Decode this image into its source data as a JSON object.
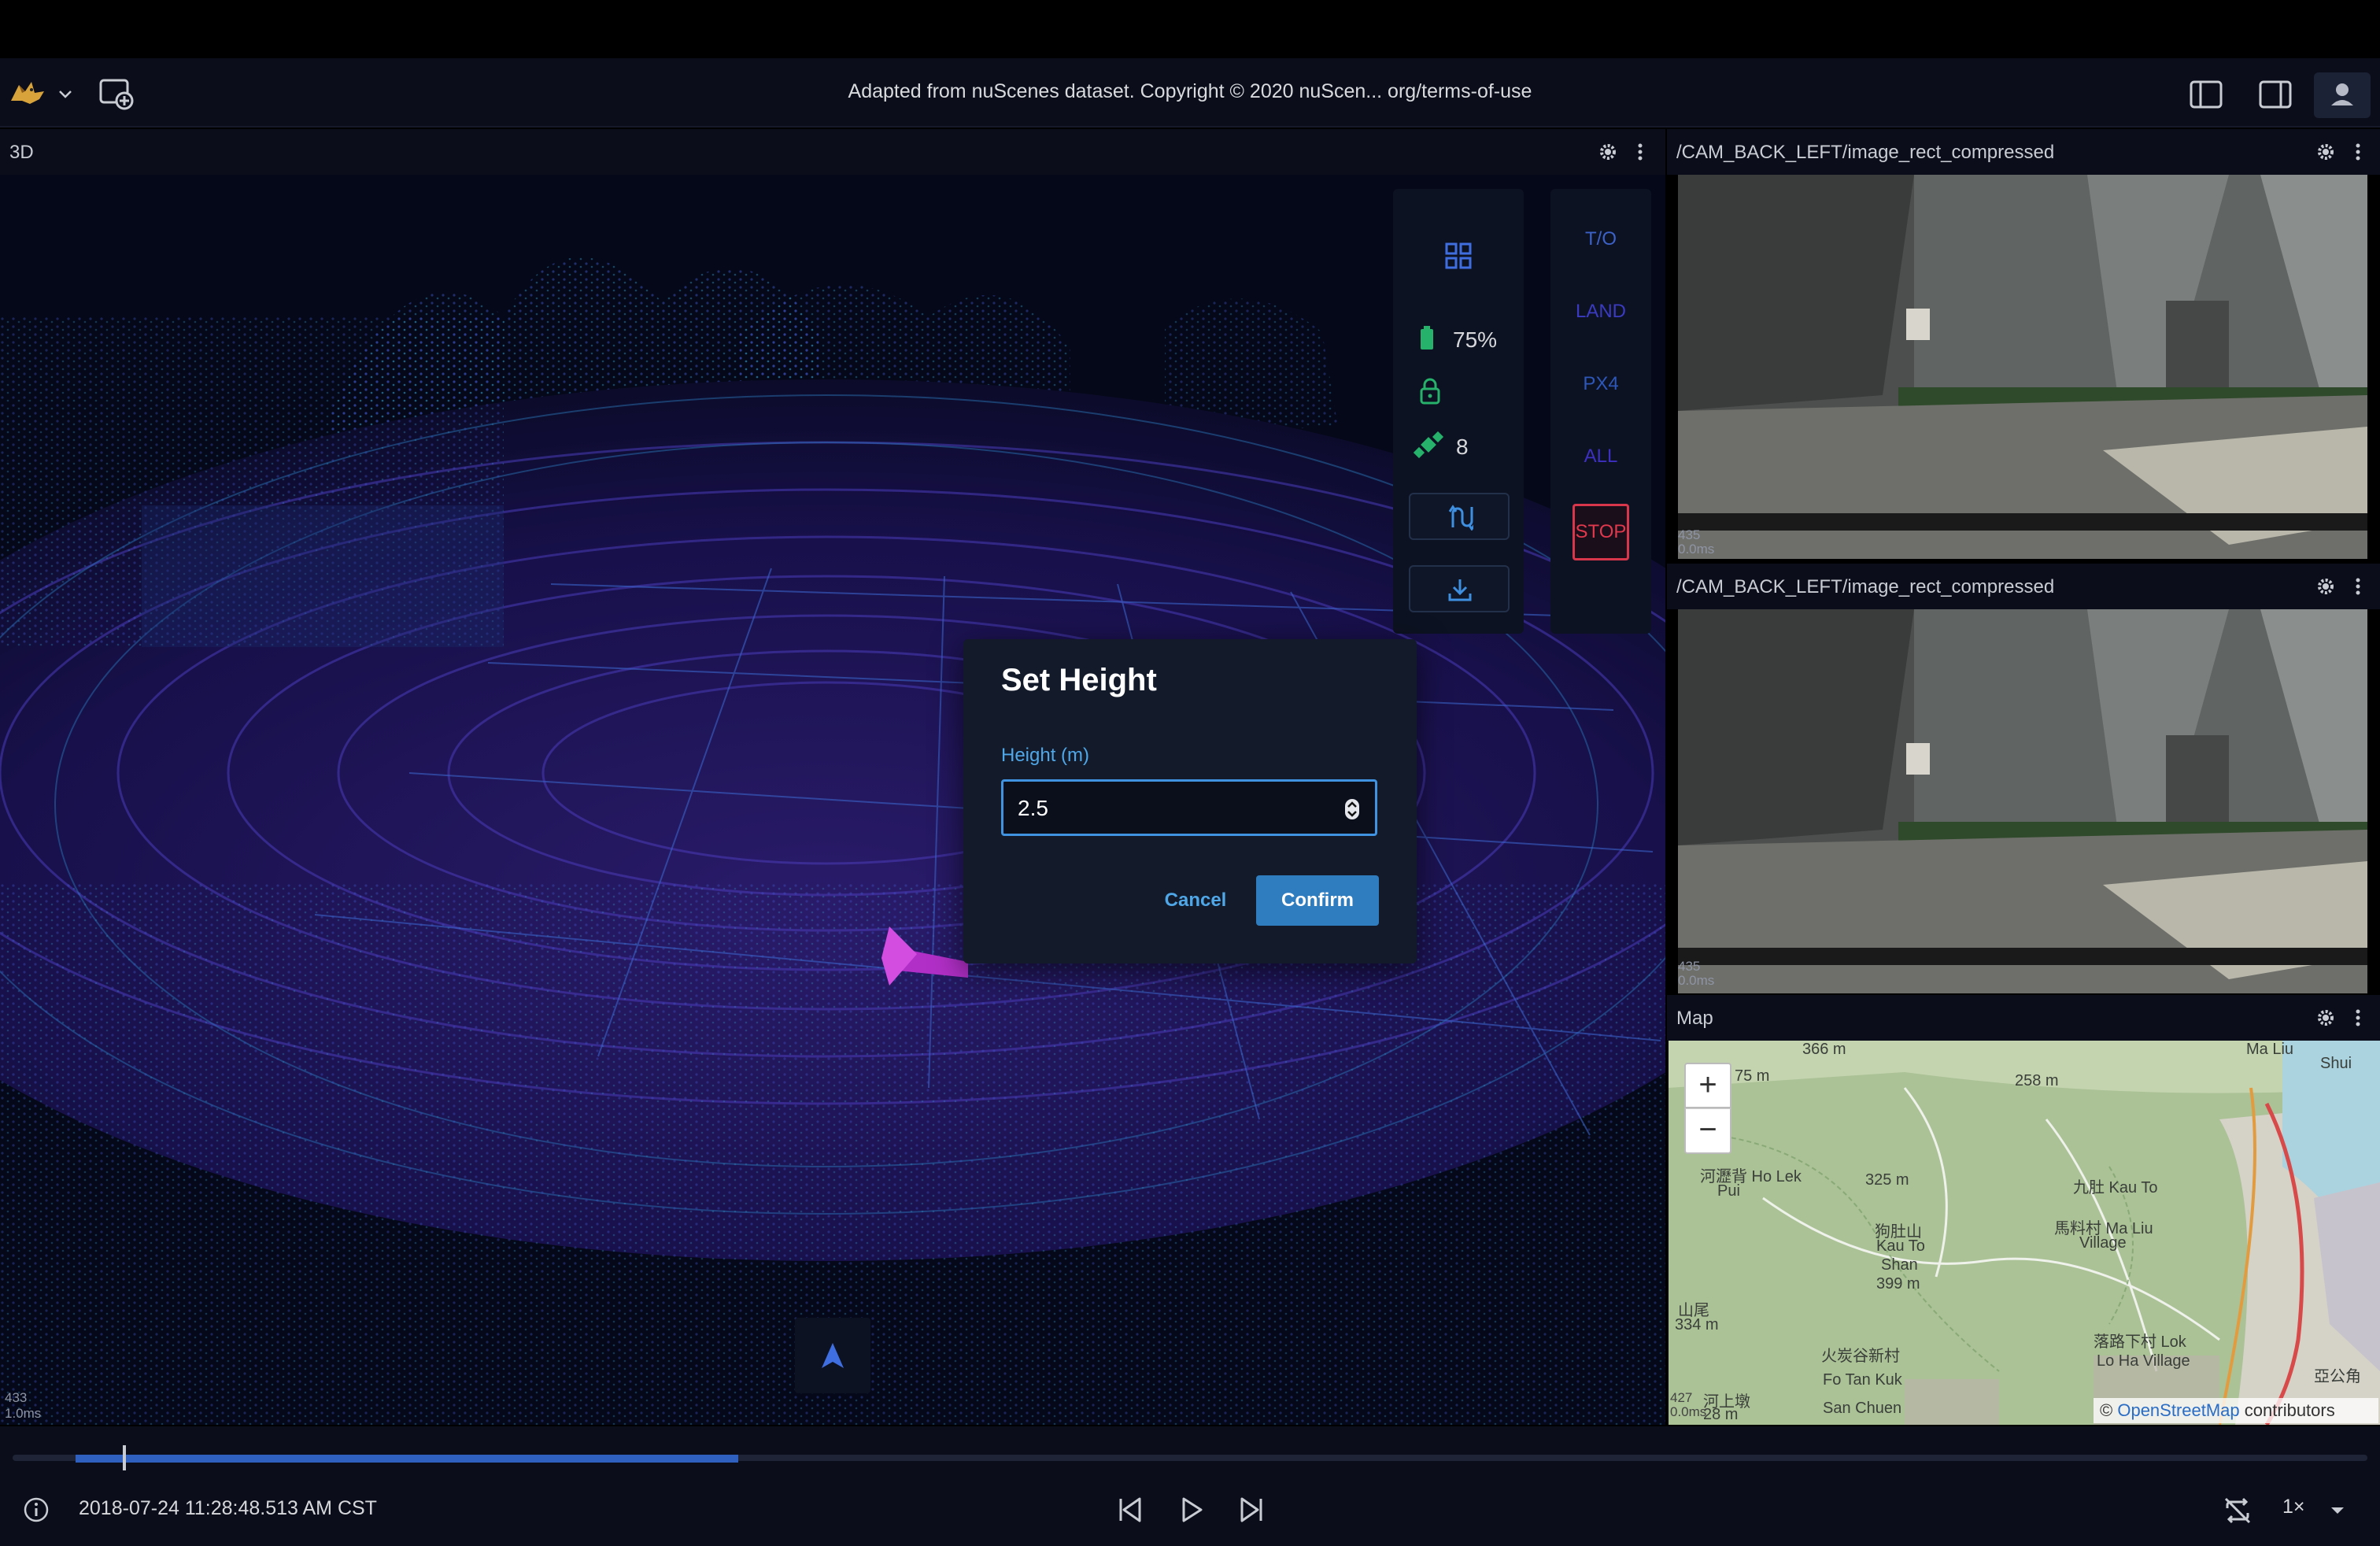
{
  "header": {
    "title": "Adapted from nuScenes dataset. Copyright © 2020 nuScen... org/terms-of-use",
    "logo_icon": "foxglove-logo-icon",
    "new_layout_icon": "add-panel-icon",
    "left_sidebar_icon": "left-sidebar-icon",
    "right_sidebar_icon": "right-sidebar-icon",
    "user_icon": "user-icon"
  },
  "panel_3d": {
    "title": "3D",
    "frame_count": "433",
    "frame_time": "1.0ms"
  },
  "status_widget": {
    "battery_level": "75%",
    "satellites": "8",
    "icons": [
      "grid-icon",
      "battery-icon",
      "lock-icon",
      "satellite-icon",
      "path-icon",
      "download-icon"
    ]
  },
  "command_widget": {
    "takeoff": "T/O",
    "land": "LAND",
    "px4": "PX4",
    "all": "ALL",
    "stop": "STOP"
  },
  "dialog": {
    "title": "Set Height",
    "field_label": "Height (m)",
    "value": "2.5",
    "cancel": "Cancel",
    "confirm": "Confirm"
  },
  "camera_panels": [
    {
      "title": "/CAM_BACK_LEFT/image_rect_compressed",
      "frame_count": "435",
      "frame_time": "0.0ms"
    },
    {
      "title": "/CAM_BACK_LEFT/image_rect_compressed",
      "frame_count": "435",
      "frame_time": "0.0ms"
    }
  ],
  "map": {
    "title": "Map",
    "zoom_in": "+",
    "zoom_out": "−",
    "frame_count": "427",
    "frame_time": "0.0ms",
    "attribution_prefix": "©",
    "attribution_link": "OpenStreetMap",
    "attribution_suffix": "contributors",
    "labels": {
      "l1": "366 m",
      "l2": "75 m",
      "l3": "258 m",
      "l4": "河瀝背 Ho Lek",
      "l5": "Pui",
      "l6": "325 m",
      "l7": "九肚 Kau To",
      "l8": "馬料村 Ma Liu",
      "l9": "Village",
      "l10": "狗肚山",
      "l11": "Kau To",
      "l12": "Shan",
      "l13": "399 m",
      "l14": "山尾",
      "l15": "334 m",
      "l16": "火炭谷新村",
      "l17": "Fo Tan Kuk",
      "l18": "San Chuen",
      "l19": "河上墩",
      "l20": "28 m",
      "l21": "落路下村 Lok",
      "l22": "Lo Ha Village",
      "l23": "Shui",
      "l24": "亞公角",
      "l25": "Ma Liu"
    }
  },
  "playback": {
    "timestamp": "2018-07-24 11:28:48.513 AM CST",
    "speed": "1×",
    "progress_fraction": 0.28
  },
  "colors": {
    "accent": "#2f7dbf",
    "stop": "#e0384c",
    "cmd_text": "#3c4fc8",
    "battery": "#27b26b"
  }
}
